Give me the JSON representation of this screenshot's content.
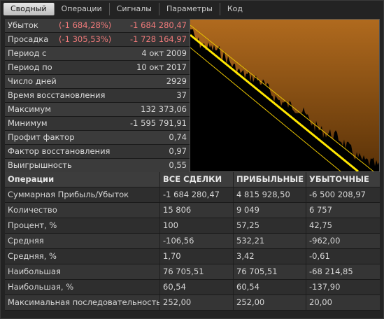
{
  "tabs": [
    "Сводный",
    "Операции",
    "Сигналы",
    "Параметры",
    "Код"
  ],
  "active_tab": 0,
  "summary": [
    {
      "label": "Убыток",
      "pct": "(-1 684,28%)",
      "value": "-1 684 280,47",
      "neg": true
    },
    {
      "label": "Просадка",
      "pct": "(-1 305,53%)",
      "value": "-1 728 164,97",
      "neg": true
    },
    {
      "label": "Период с",
      "pct": "",
      "value": "4 окт 2009",
      "neg": false
    },
    {
      "label": "Период по",
      "pct": "",
      "value": "10 окт 2017",
      "neg": false
    },
    {
      "label": "Число дней",
      "pct": "",
      "value": "2929",
      "neg": false
    },
    {
      "label": "Время восстановления",
      "pct": "",
      "value": "37",
      "neg": false
    },
    {
      "label": "Максимум",
      "pct": "",
      "value": "132 373,06",
      "neg": false
    },
    {
      "label": "Минимум",
      "pct": "",
      "value": "-1 595 791,91",
      "neg": false
    },
    {
      "label": "Профит фактор",
      "pct": "",
      "value": "0,74",
      "neg": false
    },
    {
      "label": "Фактор восстановления",
      "pct": "",
      "value": "0,97",
      "neg": false
    },
    {
      "label": "Выигрышность",
      "pct": "",
      "value": "0,55",
      "neg": false
    }
  ],
  "chart": {
    "background_top": "#b06a1e",
    "background_bottom": "#5a3208",
    "fill_color": "#000000",
    "line_color": "#ffe600",
    "trend_color": "#e8c300"
  },
  "table": {
    "headers": [
      "Операции",
      "ВСЕ СДЕЛКИ",
      "ПРИБЫЛЬНЫЕ",
      "УБЫТОЧНЫЕ"
    ],
    "rows": [
      [
        "Суммарная Прибыль/Убыток",
        "-1 684 280,47",
        "4 815 928,50",
        "-6 500 208,97"
      ],
      [
        "Количество",
        "15 806",
        "9 049",
        "6 757"
      ],
      [
        "Процент, %",
        "100",
        "57,25",
        "42,75"
      ],
      [
        "Средняя",
        "-106,56",
        "532,21",
        "-962,00"
      ],
      [
        "Средняя, %",
        "1,70",
        "3,42",
        "-0,61"
      ],
      [
        "Наибольшая",
        "76 705,51",
        "76 705,51",
        "-68 214,85"
      ],
      [
        "Наибольшая, %",
        "60,54",
        "60,54",
        "-137,90"
      ],
      [
        "Максимальная последовательность",
        "252,00",
        "252,00",
        "20,00"
      ]
    ]
  }
}
